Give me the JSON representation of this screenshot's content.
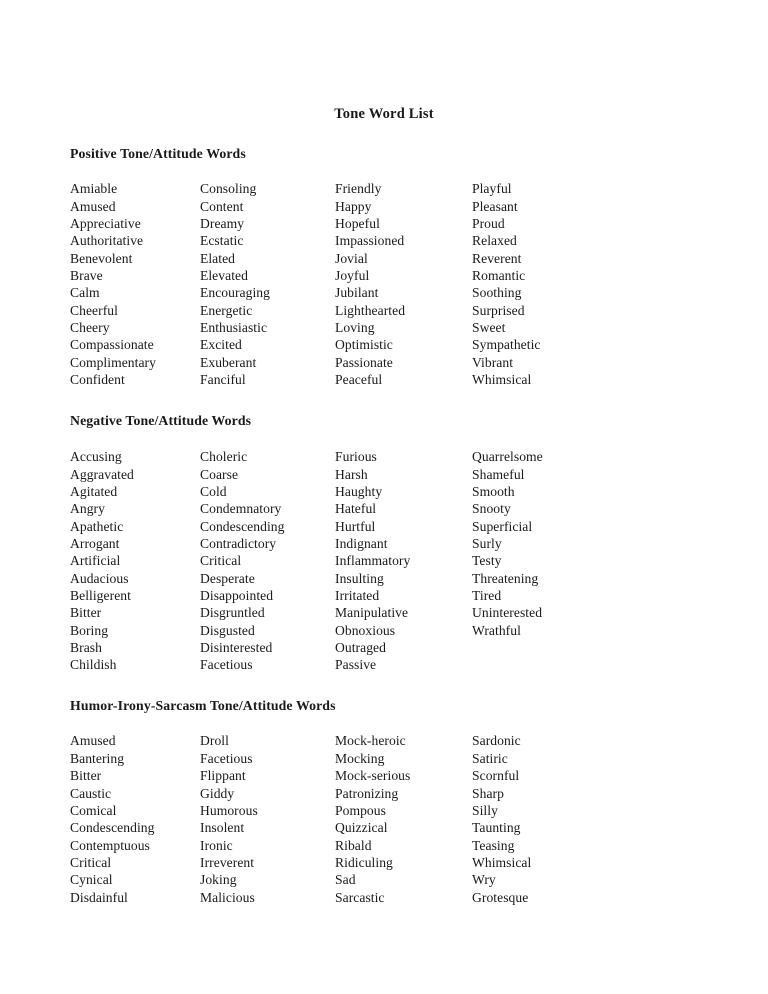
{
  "document": {
    "title": "Tone Word List",
    "background_color": "#ffffff",
    "text_color": "#1a1a1a"
  },
  "sections": [
    {
      "id": "positive",
      "header": "Positive Tone/Attitude Words",
      "columns": [
        [
          "Amiable",
          "Amused",
          "Appreciative",
          "Authoritative",
          "Benevolent",
          "Brave",
          "Calm",
          "Cheerful",
          "Cheery",
          "Compassionate",
          "Complimentary",
          "Confident"
        ],
        [
          "Consoling",
          "Content",
          "Dreamy",
          "Ecstatic",
          "Elated",
          "Elevated",
          "Encouraging",
          "Energetic",
          "Enthusiastic",
          "Excited",
          "Exuberant",
          "Fanciful"
        ],
        [
          "Friendly",
          "Happy",
          "Hopeful",
          "Impassioned",
          "Jovial",
          "Joyful",
          "Jubilant",
          "Lighthearted",
          "Loving",
          "Optimistic",
          "Passionate",
          "Peaceful"
        ],
        [
          "Playful",
          "Pleasant",
          "Proud",
          "Relaxed",
          "Reverent",
          "Romantic",
          "Soothing",
          "Surprised",
          "Sweet",
          "Sympathetic",
          "Vibrant",
          "Whimsical"
        ]
      ]
    },
    {
      "id": "negative",
      "header": "Negative Tone/Attitude Words",
      "columns": [
        [
          "Accusing",
          "Aggravated",
          "Agitated",
          "Angry",
          "Apathetic",
          "Arrogant",
          "Artificial",
          "Audacious",
          "Belligerent",
          "Bitter",
          "Boring",
          "Brash",
          "Childish"
        ],
        [
          "Choleric",
          "Coarse",
          "Cold",
          "Condemnatory",
          "Condescending",
          "Contradictory",
          "Critical",
          "Desperate",
          "Disappointed",
          "Disgruntled",
          "Disgusted",
          "Disinterested",
          "Facetious"
        ],
        [
          "Furious",
          "Harsh",
          "Haughty",
          "Hateful",
          "Hurtful",
          "Indignant",
          "Inflammatory",
          "Insulting",
          "Irritated",
          "Manipulative",
          "Obnoxious",
          "Outraged",
          "Passive"
        ],
        [
          "Quarrelsome",
          "Shameful",
          "Smooth",
          "Snooty",
          "Superficial",
          "Surly",
          "Testy",
          "Threatening",
          "Tired",
          "Uninterested",
          "Wrathful"
        ]
      ]
    },
    {
      "id": "humor-irony-sarcasm",
      "header": "Humor-Irony-Sarcasm Tone/Attitude Words",
      "columns": [
        [
          "Amused",
          "Bantering",
          "Bitter",
          "Caustic",
          "Comical",
          "Condescending",
          "Contemptuous",
          "Critical",
          "Cynical",
          "Disdainful"
        ],
        [
          "Droll",
          "Facetious",
          "Flippant",
          "Giddy",
          "Humorous",
          "Insolent",
          "Ironic",
          "Irreverent",
          "Joking",
          "Malicious"
        ],
        [
          "Mock-heroic",
          "Mocking",
          "Mock-serious",
          "Patronizing",
          "Pompous",
          "Quizzical",
          "Ribald",
          "Ridiculing",
          "Sad",
          "Sarcastic"
        ],
        [
          "Sardonic",
          "Satiric",
          "Scornful",
          "Sharp",
          "Silly",
          "Taunting",
          "Teasing",
          "Whimsical",
          "Wry",
          "Grotesque"
        ]
      ]
    }
  ]
}
